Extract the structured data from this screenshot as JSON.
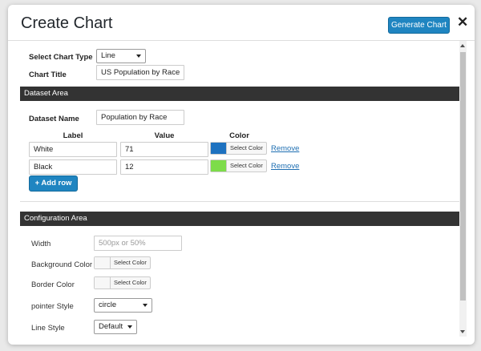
{
  "window": {
    "title": "Create Chart",
    "generate_label": "Generate Chart",
    "close_glyph": "✕"
  },
  "chart_settings": {
    "type_label": "Select Chart Type",
    "type_value": "Line",
    "title_label": "Chart Title",
    "title_value": "US Population by Race"
  },
  "dataset": {
    "section_title": "Dataset Area",
    "name_label": "Dataset Name",
    "name_value": "Population by Race",
    "columns": [
      "Label",
      "Value",
      "Color"
    ],
    "rows": [
      {
        "label": "White",
        "value": "71",
        "color": "#1e72c0",
        "color_btn": "Select Color",
        "remove": "Remove"
      },
      {
        "label": "Black",
        "value": "12",
        "color": "#7ddc4a",
        "color_btn": "Select Color",
        "remove": "Remove"
      }
    ],
    "add_row_label": "+ Add row"
  },
  "config": {
    "section_title": "Configuration Area",
    "width_label": "Width",
    "width_placeholder": "500px or 50%",
    "bg_color_label": "Background Color",
    "bg_color_btn": "Select Color",
    "bg_color_value": "#f7f7f7",
    "border_color_label": "Border Color",
    "border_color_btn": "Select Color",
    "border_color_value": "#f7f7f7",
    "pointer_label": "pointer Style",
    "pointer_value": "circle",
    "line_label": "Line Style",
    "line_value": "Default"
  }
}
